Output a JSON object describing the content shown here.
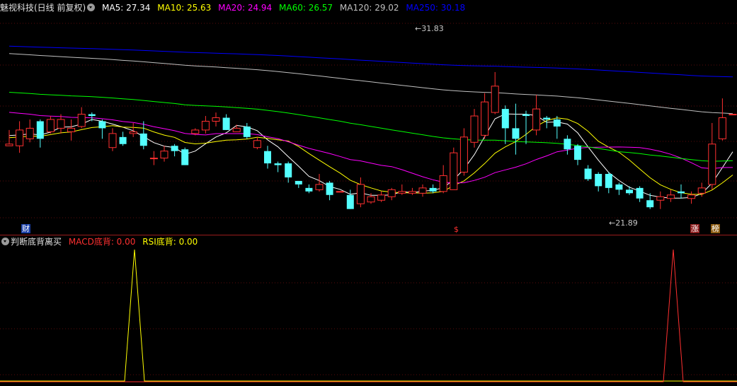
{
  "header": {
    "stock_title": "魅视科技(日线 前复权)",
    "ma": [
      {
        "label": "MA5: 27.34",
        "color": "#ffffff"
      },
      {
        "label": "MA10: 25.63",
        "color": "#ffff00"
      },
      {
        "label": "MA20: 24.94",
        "color": "#ff00ff"
      },
      {
        "label": "MA60: 26.57",
        "color": "#00ff00"
      },
      {
        "label": "MA120: 29.02",
        "color": "#c0c0c0"
      },
      {
        "label": "MA250: 30.18",
        "color": "#0000ff"
      }
    ]
  },
  "annotations": {
    "high_label": "31.83",
    "low_label": "21.89",
    "badge_finance": "财",
    "badge_dollar": "$",
    "badge_rise": "涨",
    "badge_rank": "榜"
  },
  "indicator": {
    "name": "判断底背离买",
    "macd_label": "MACD底背: 0.00",
    "rsi_label": "RSI底背: 0.00",
    "macd_color": "#ff3030",
    "rsi_color": "#ffff00"
  },
  "chart_data": {
    "type": "candlestick",
    "price_range": [
      21.0,
      33.0
    ],
    "up_color": "#ff3030",
    "down_color": "#54ffff",
    "candles": [
      [
        25.5,
        25.6,
        26.4,
        25.5
      ],
      [
        25.5,
        26.4,
        26.9,
        25.1
      ],
      [
        25.9,
        26.5,
        27.0,
        25.7
      ],
      [
        26.9,
        25.9,
        27.0,
        25.4
      ],
      [
        26.3,
        27.0,
        27.2,
        26.2
      ],
      [
        26.5,
        27.0,
        27.3,
        26.2
      ],
      [
        26.3,
        26.5,
        27.0,
        25.8
      ],
      [
        26.6,
        27.3,
        27.7,
        26.5
      ],
      [
        27.3,
        27.2,
        27.4,
        26.9
      ],
      [
        26.9,
        26.5,
        27.0,
        25.9
      ],
      [
        25.4,
        26.2,
        26.5,
        25.2
      ],
      [
        26.0,
        25.6,
        26.3,
        25.5
      ],
      [
        26.2,
        26.3,
        26.8,
        26.0
      ],
      [
        26.2,
        25.5,
        26.9,
        25.3
      ],
      [
        24.8,
        24.8,
        25.2,
        24.4
      ],
      [
        24.8,
        25.2,
        25.5,
        24.6
      ],
      [
        25.5,
        25.2,
        25.6,
        24.9
      ],
      [
        25.3,
        24.4,
        25.4,
        24.4
      ],
      [
        26.2,
        26.4,
        26.5,
        26.1
      ],
      [
        26.4,
        26.9,
        27.2,
        26.2
      ],
      [
        26.9,
        27.1,
        27.4,
        26.6
      ],
      [
        27.1,
        26.4,
        27.3,
        26.4
      ],
      [
        26.3,
        26.5,
        26.7,
        26.3
      ],
      [
        26.6,
        26.0,
        26.8,
        25.9
      ],
      [
        25.4,
        25.8,
        26.0,
        25.3
      ],
      [
        25.2,
        24.5,
        25.5,
        24.2
      ],
      [
        24.5,
        24.4,
        24.6,
        24.0
      ],
      [
        24.5,
        23.7,
        24.6,
        23.4
      ],
      [
        23.5,
        23.3,
        23.5,
        23.1
      ],
      [
        23.1,
        22.9,
        23.3,
        22.8
      ],
      [
        23.0,
        23.3,
        23.9,
        22.9
      ],
      [
        23.4,
        22.7,
        23.5,
        22.4
      ],
      [
        22.9,
        22.9,
        22.9,
        22.9
      ],
      [
        22.7,
        21.9,
        23.0,
        21.9
      ],
      [
        22.2,
        23.3,
        23.7,
        22.0
      ],
      [
        22.3,
        22.6,
        22.8,
        22.2
      ],
      [
        22.4,
        22.7,
        22.9,
        22.3
      ],
      [
        22.6,
        23.0,
        23.1,
        22.4
      ],
      [
        22.8,
        22.9,
        23.3,
        22.7
      ],
      [
        22.8,
        22.9,
        23.1,
        22.7
      ],
      [
        22.8,
        23.1,
        23.3,
        22.6
      ],
      [
        23.1,
        22.9,
        23.3,
        22.8
      ],
      [
        22.9,
        23.8,
        24.4,
        22.8
      ],
      [
        23.0,
        25.1,
        25.4,
        23.2
      ],
      [
        24.0,
        26.0,
        26.5,
        23.8
      ],
      [
        25.7,
        27.2,
        27.6,
        25.4
      ],
      [
        26.1,
        28.0,
        28.5,
        25.9
      ],
      [
        27.4,
        28.9,
        29.7,
        27.3
      ],
      [
        27.6,
        26.5,
        27.8,
        25.6
      ],
      [
        26.5,
        25.9,
        27.9,
        25.0
      ],
      [
        27.3,
        27.2,
        27.5,
        25.6
      ],
      [
        26.4,
        27.6,
        28.4,
        26.1
      ],
      [
        27.1,
        27.0,
        27.2,
        26.5
      ],
      [
        27.0,
        26.6,
        27.2,
        25.9
      ],
      [
        25.9,
        25.3,
        26.1,
        25.0
      ],
      [
        25.5,
        24.7,
        25.6,
        24.4
      ],
      [
        24.2,
        23.6,
        24.4,
        23.5
      ],
      [
        23.9,
        23.2,
        24.0,
        22.9
      ],
      [
        23.9,
        23.1,
        24.0,
        22.8
      ],
      [
        23.3,
        23.0,
        23.4,
        22.7
      ],
      [
        23.0,
        22.8,
        23.2,
        22.7
      ],
      [
        23.1,
        22.5,
        23.2,
        22.3
      ],
      [
        22.4,
        22.0,
        22.8,
        21.9
      ],
      [
        22.4,
        22.6,
        22.9,
        21.9
      ],
      [
        22.5,
        22.7,
        23.0,
        22.3
      ],
      [
        22.9,
        22.8,
        23.3,
        22.5
      ],
      [
        22.5,
        22.7,
        22.9,
        22.2
      ],
      [
        22.8,
        23.1,
        23.4,
        22.6
      ],
      [
        23.3,
        25.6,
        26.8,
        23.0
      ],
      [
        25.9,
        27.1,
        28.2,
        25.8
      ],
      [
        27.3,
        27.3,
        27.3,
        27.3
      ]
    ]
  }
}
